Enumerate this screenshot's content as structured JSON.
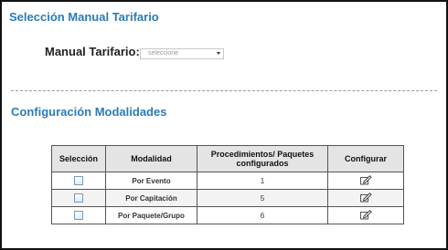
{
  "header": {
    "title": "Selección Manual Tarifario"
  },
  "tarifario": {
    "label": "Manual Tarifario:",
    "select_value": "seleccione"
  },
  "modalidades": {
    "title": "Configuración Modalidades",
    "table": {
      "columns": [
        "Selección",
        "Modalidad",
        "Procedimientos/ Paquetes configurados",
        "Configurar"
      ],
      "rows": [
        {
          "modalidad": "Por Evento",
          "count": "1",
          "configure_icon": "edit-icon"
        },
        {
          "modalidad": "Por Capitación",
          "count": "5",
          "configure_icon": "edit-icon"
        },
        {
          "modalidad": "Por Paquete/Grupo",
          "count": "6",
          "configure_icon": "edit-icon"
        }
      ]
    }
  },
  "colors": {
    "section_title": "#2b7bb9",
    "header_bg": "#e4e4e4",
    "border": "#555555"
  }
}
